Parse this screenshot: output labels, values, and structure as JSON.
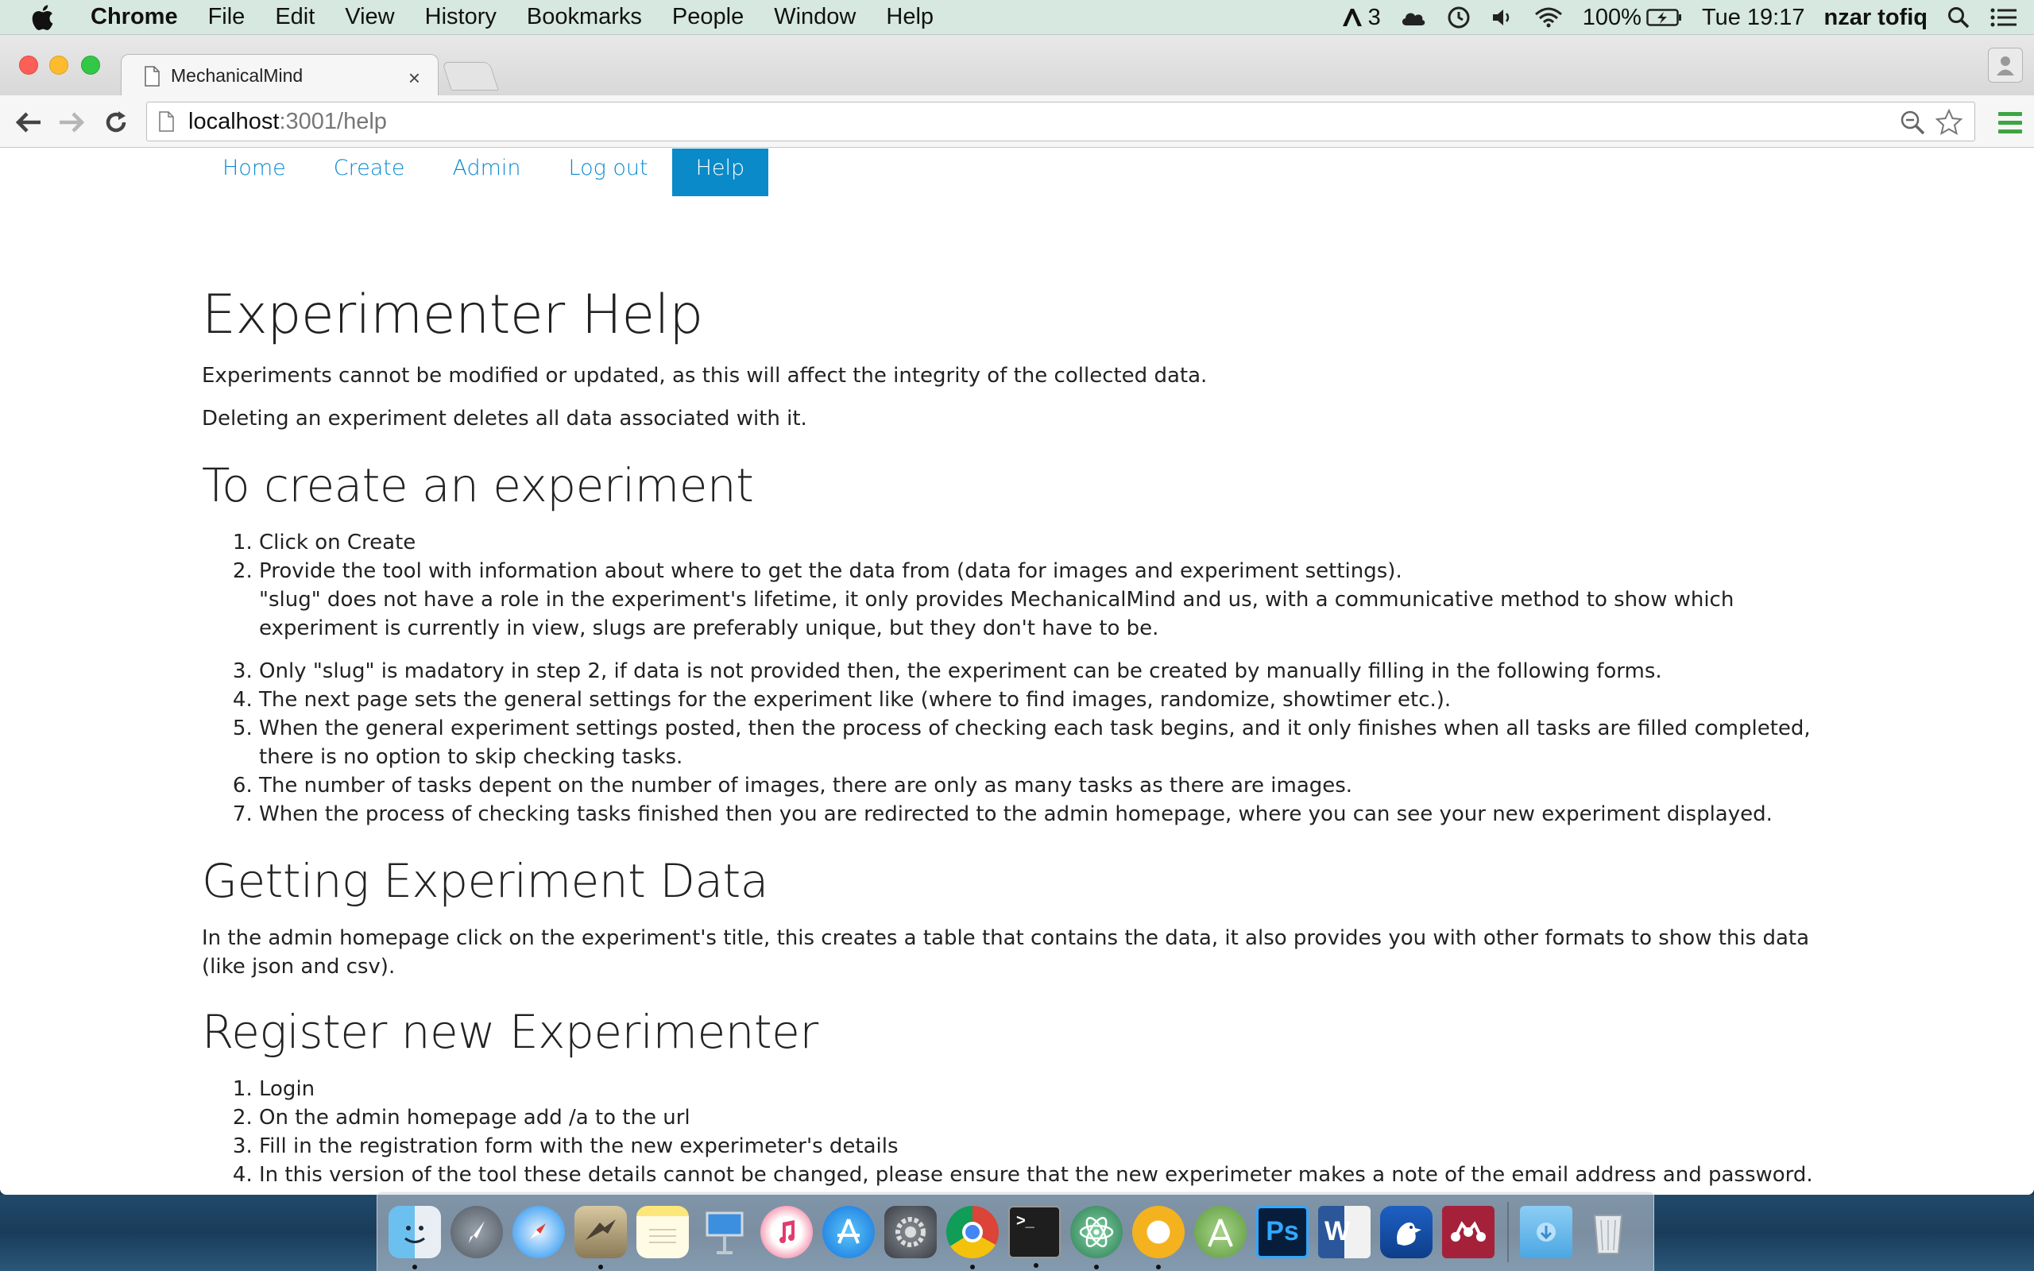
{
  "menubar": {
    "app": "Chrome",
    "items": [
      "File",
      "Edit",
      "View",
      "History",
      "Bookmarks",
      "People",
      "Window",
      "Help"
    ],
    "adobe_count": "3",
    "battery": "100%",
    "clock": "Tue 19:17",
    "user": "nzar tofiq"
  },
  "browser": {
    "tab_title": "MechanicalMind",
    "url_host": "localhost",
    "url_path": ":3001/help"
  },
  "nav": {
    "items": [
      "Home",
      "Create",
      "Admin",
      "Log out",
      "Help"
    ],
    "active": "Help"
  },
  "page": {
    "title": "Experimenter Help",
    "intro": [
      "Experiments cannot be modified or updated, as this will affect the integrity of the collected data.",
      "Deleting an experiment deletes all data associated with it."
    ],
    "create_heading": "To create an experiment",
    "create_steps": [
      "Click on Create",
      "Provide the tool with information about where to get the data from (data for images and experiment settings).",
      "Only \"slug\" is madatory in step 2, if data is not provided then, the experiment can be created by manually filling in the following forms.",
      "The next page sets the general settings for the experiment like (where to find images, randomize, showtimer etc.).",
      "When the general experiment settings posted, then the process of checking each task begins, and it only finishes when all tasks are filled completed, there is no option to skip checking tasks.",
      "The number of tasks depent on the number of images, there are only as many tasks as there are images.",
      "When the process of checking tasks finished then you are redirected to the admin homepage, where you can see your new experiment displayed."
    ],
    "create_step2_note": "\"slug\" does not have a role in the experiment's lifetime, it only provides MechanicalMind and us, with a communicative method to show which experiment is currently in view, slugs are preferably unique, but they don't have to be.",
    "data_heading": "Getting Experiment Data",
    "data_text": "In the admin homepage click on the experiment's title, this creates a table that contains the data, it also provides you with other formats to show this data (like json and csv).",
    "register_heading": "Register new Experimenter",
    "register_steps": [
      "Login",
      "On the admin homepage add /a to the url",
      "Fill in the registration form with the new experimeter's details",
      "In this version of the tool these details cannot be changed, please ensure that the new experimeter makes a note of the email address and password."
    ]
  },
  "dock": {
    "apps": [
      "finder",
      "launchpad",
      "safari",
      "mail",
      "notes",
      "keynote",
      "itunes",
      "app-store",
      "system-preferences",
      "chrome",
      "terminal",
      "atom",
      "chrome-canary",
      "android-studio",
      "photoshop",
      "word",
      "cyberduck",
      "mendeley",
      "downloads",
      "trash"
    ]
  },
  "colors": {
    "link": "#0a8ad0",
    "active_nav_bg": "#0a8ac8",
    "menubar_bg": "#d6e8e0"
  }
}
